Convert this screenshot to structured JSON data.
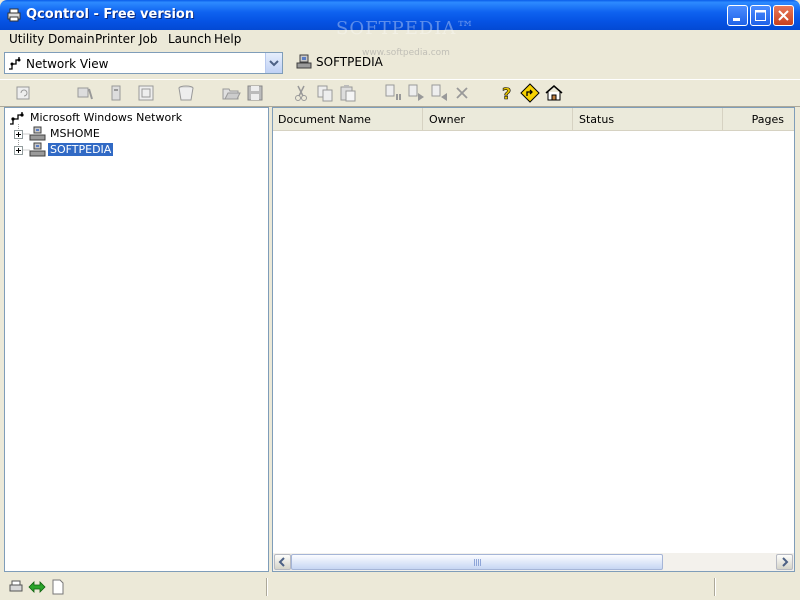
{
  "window": {
    "title": "Qcontrol - Free version"
  },
  "watermark": {
    "brand": "SOFTPEDIA",
    "trademark": "™",
    "url": "www.softpedia.com"
  },
  "menu": [
    "Utility",
    "Domain",
    "Printer",
    "Job",
    "Launch",
    "Help"
  ],
  "view_select": {
    "value": "Network View"
  },
  "current_server": "SOFTPEDIA",
  "tree": {
    "root": "Microsoft Windows Network",
    "children": [
      "MSHOME",
      "SOFTPEDIA"
    ],
    "selected": "SOFTPEDIA"
  },
  "table": {
    "columns": [
      "Document Name",
      "Owner",
      "Status",
      "Pages"
    ],
    "rows": []
  },
  "toolbar_icons": [
    "refresh-icon",
    "printer-settings-icon",
    "printer-icon",
    "printer-properties-icon",
    "trash-icon",
    "open-folder-icon",
    "save-icon",
    "cut-icon",
    "copy-icon",
    "paste-icon",
    "pause-job-icon",
    "resume-job-icon",
    "restart-job-icon",
    "delete-job-icon",
    "help-icon",
    "direction-icon",
    "home-icon"
  ],
  "colors": {
    "titlebar": "#0A5DE9",
    "selection": "#316AC5",
    "chrome": "#ECE9D8"
  }
}
